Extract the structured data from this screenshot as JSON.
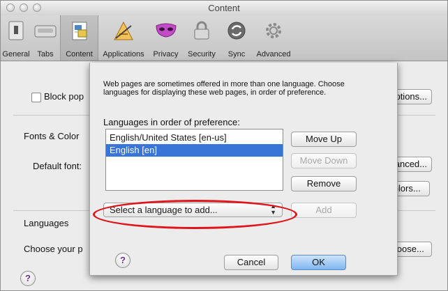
{
  "window": {
    "title": "Content"
  },
  "toolbar": {
    "items": [
      {
        "label": "General",
        "icon": "general-switch-icon"
      },
      {
        "label": "Tabs",
        "icon": "tabs-icon"
      },
      {
        "label": "Content",
        "icon": "content-page-icon",
        "selected": true
      },
      {
        "label": "Applications",
        "icon": "applications-icon"
      },
      {
        "label": "Privacy",
        "icon": "privacy-mask-icon"
      },
      {
        "label": "Security",
        "icon": "security-lock-icon"
      },
      {
        "label": "Sync",
        "icon": "sync-icon"
      },
      {
        "label": "Advanced",
        "icon": "advanced-gear-icon"
      }
    ]
  },
  "pane": {
    "block_popups_label": "Block pop",
    "exceptions_button": "ceptions...",
    "fonts_heading": "Fonts & Color",
    "default_font_label": "Default font:",
    "advanced_button": "Advanced...",
    "colors_button": "Colors...",
    "languages_heading": "Languages",
    "choose_label": "Choose your p",
    "choose_button": "Choose...",
    "help": "?"
  },
  "sheet": {
    "description": "Web pages are sometimes offered in more than one language. Choose languages for displaying these web pages, in order of preference.",
    "list_heading": "Languages in order of preference:",
    "languages": [
      {
        "label": "English/United States  [en-us]",
        "selected": false
      },
      {
        "label": "English  [en]",
        "selected": true
      }
    ],
    "move_up": "Move Up",
    "move_down": "Move Down",
    "remove": "Remove",
    "select_placeholder": "Select a language to add...",
    "add": "Add",
    "cancel": "Cancel",
    "ok": "OK",
    "help": "?"
  },
  "colors": {
    "selection": "#3875d7",
    "annotation": "#e0141b",
    "default_button": "#7fb6f0"
  }
}
